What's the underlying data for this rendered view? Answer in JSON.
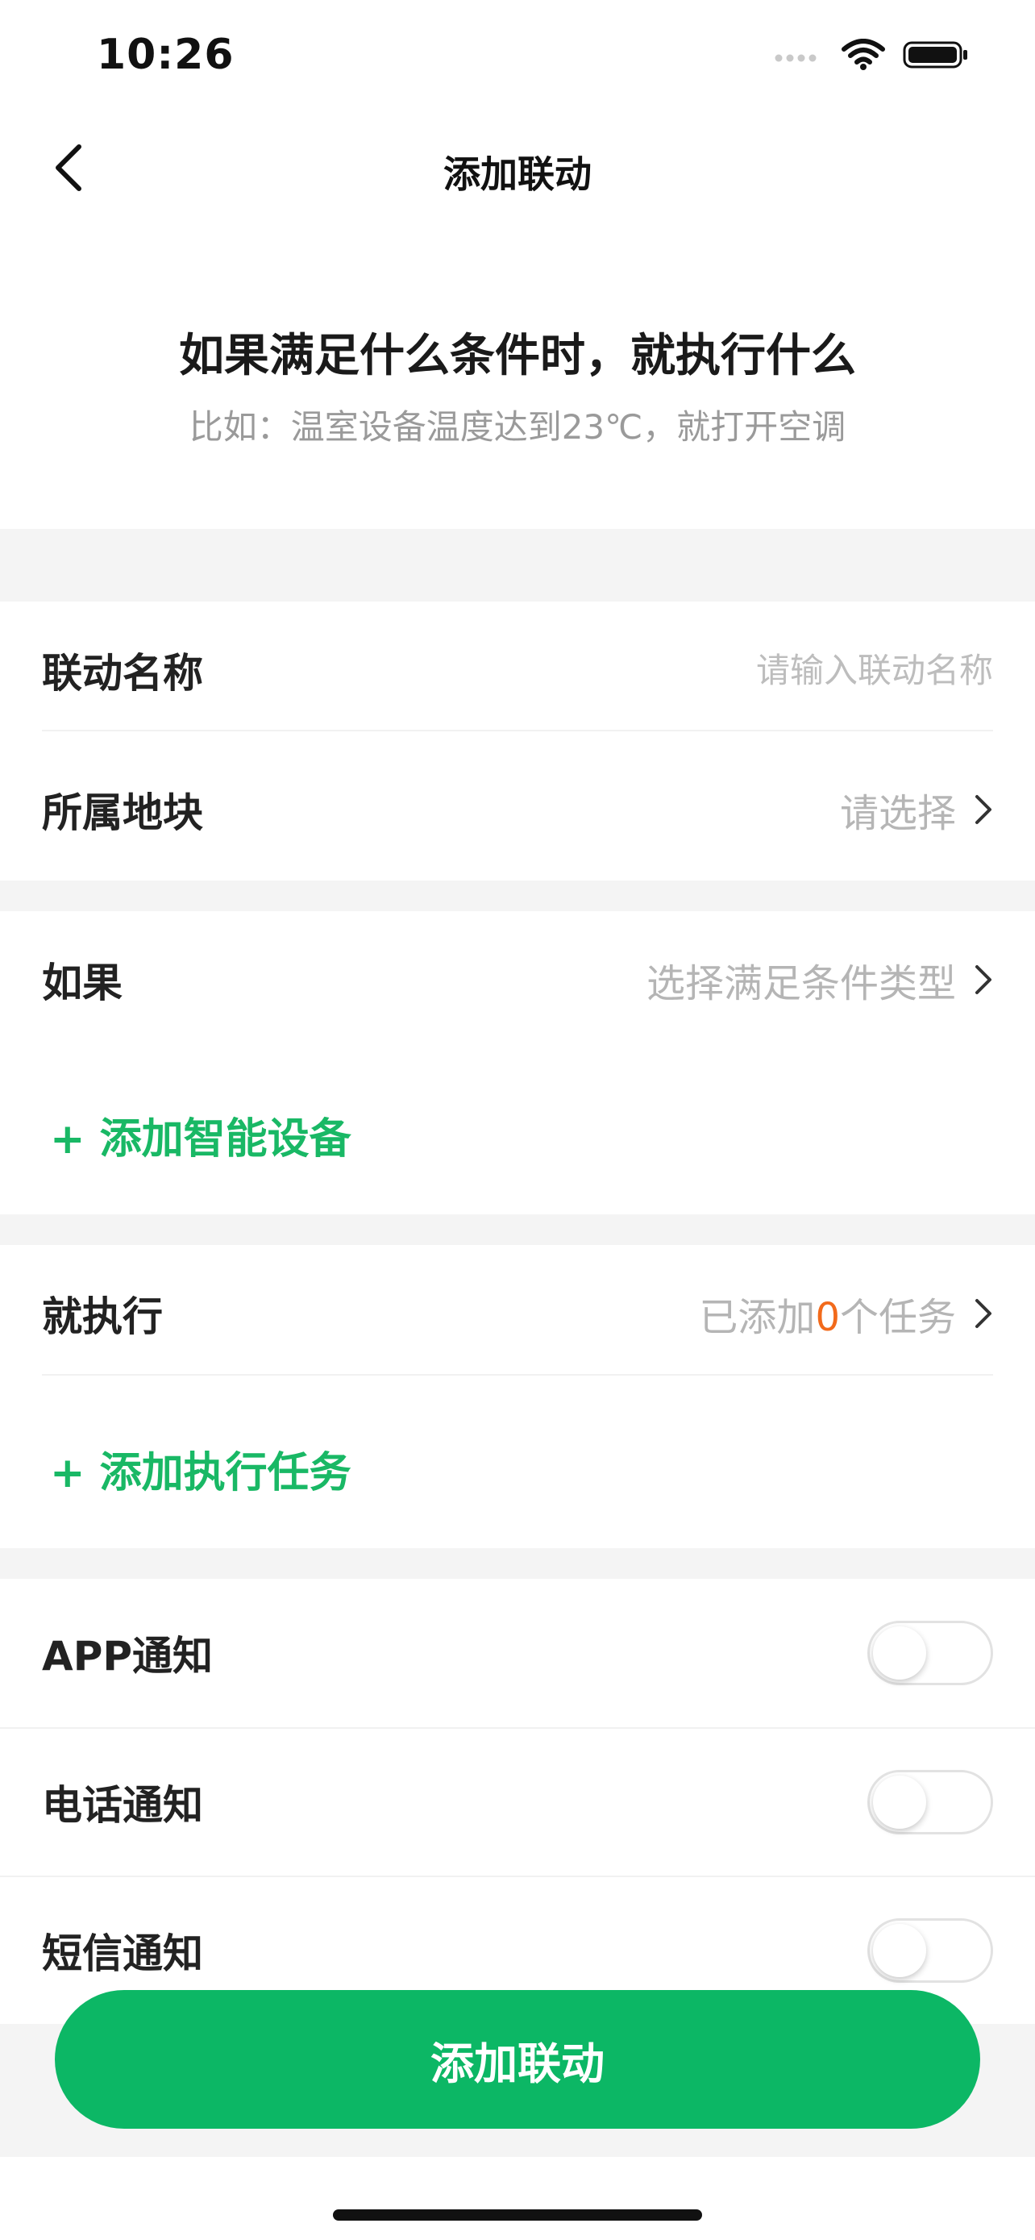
{
  "status": {
    "time": "10:26"
  },
  "nav": {
    "title": "添加联动"
  },
  "hero": {
    "title": "如果满足什么条件时，就执行什么",
    "subtitle": "比如：温室设备温度达到23℃，就打开空调"
  },
  "form": {
    "name": {
      "label": "联动名称",
      "placeholder": "请输入联动名称",
      "value": ""
    },
    "plot": {
      "label": "所属地块",
      "value": "请选择"
    }
  },
  "condition": {
    "label": "如果",
    "value": "选择满足条件类型",
    "add_label": "+ 添加智能设备"
  },
  "action": {
    "label": "就执行",
    "prefix": "已添加",
    "count": "0",
    "suffix": "个任务",
    "add_label": "+ 添加执行任务"
  },
  "notifications": [
    {
      "label": "APP通知",
      "enabled": false
    },
    {
      "label": "电话通知",
      "enabled": false
    },
    {
      "label": "短信通知",
      "enabled": false
    }
  ],
  "submit": {
    "label": "添加联动"
  },
  "colors": {
    "brand_green": "#0cb765",
    "accent_orange": "#f26a1b",
    "link_green": "#19b865"
  }
}
